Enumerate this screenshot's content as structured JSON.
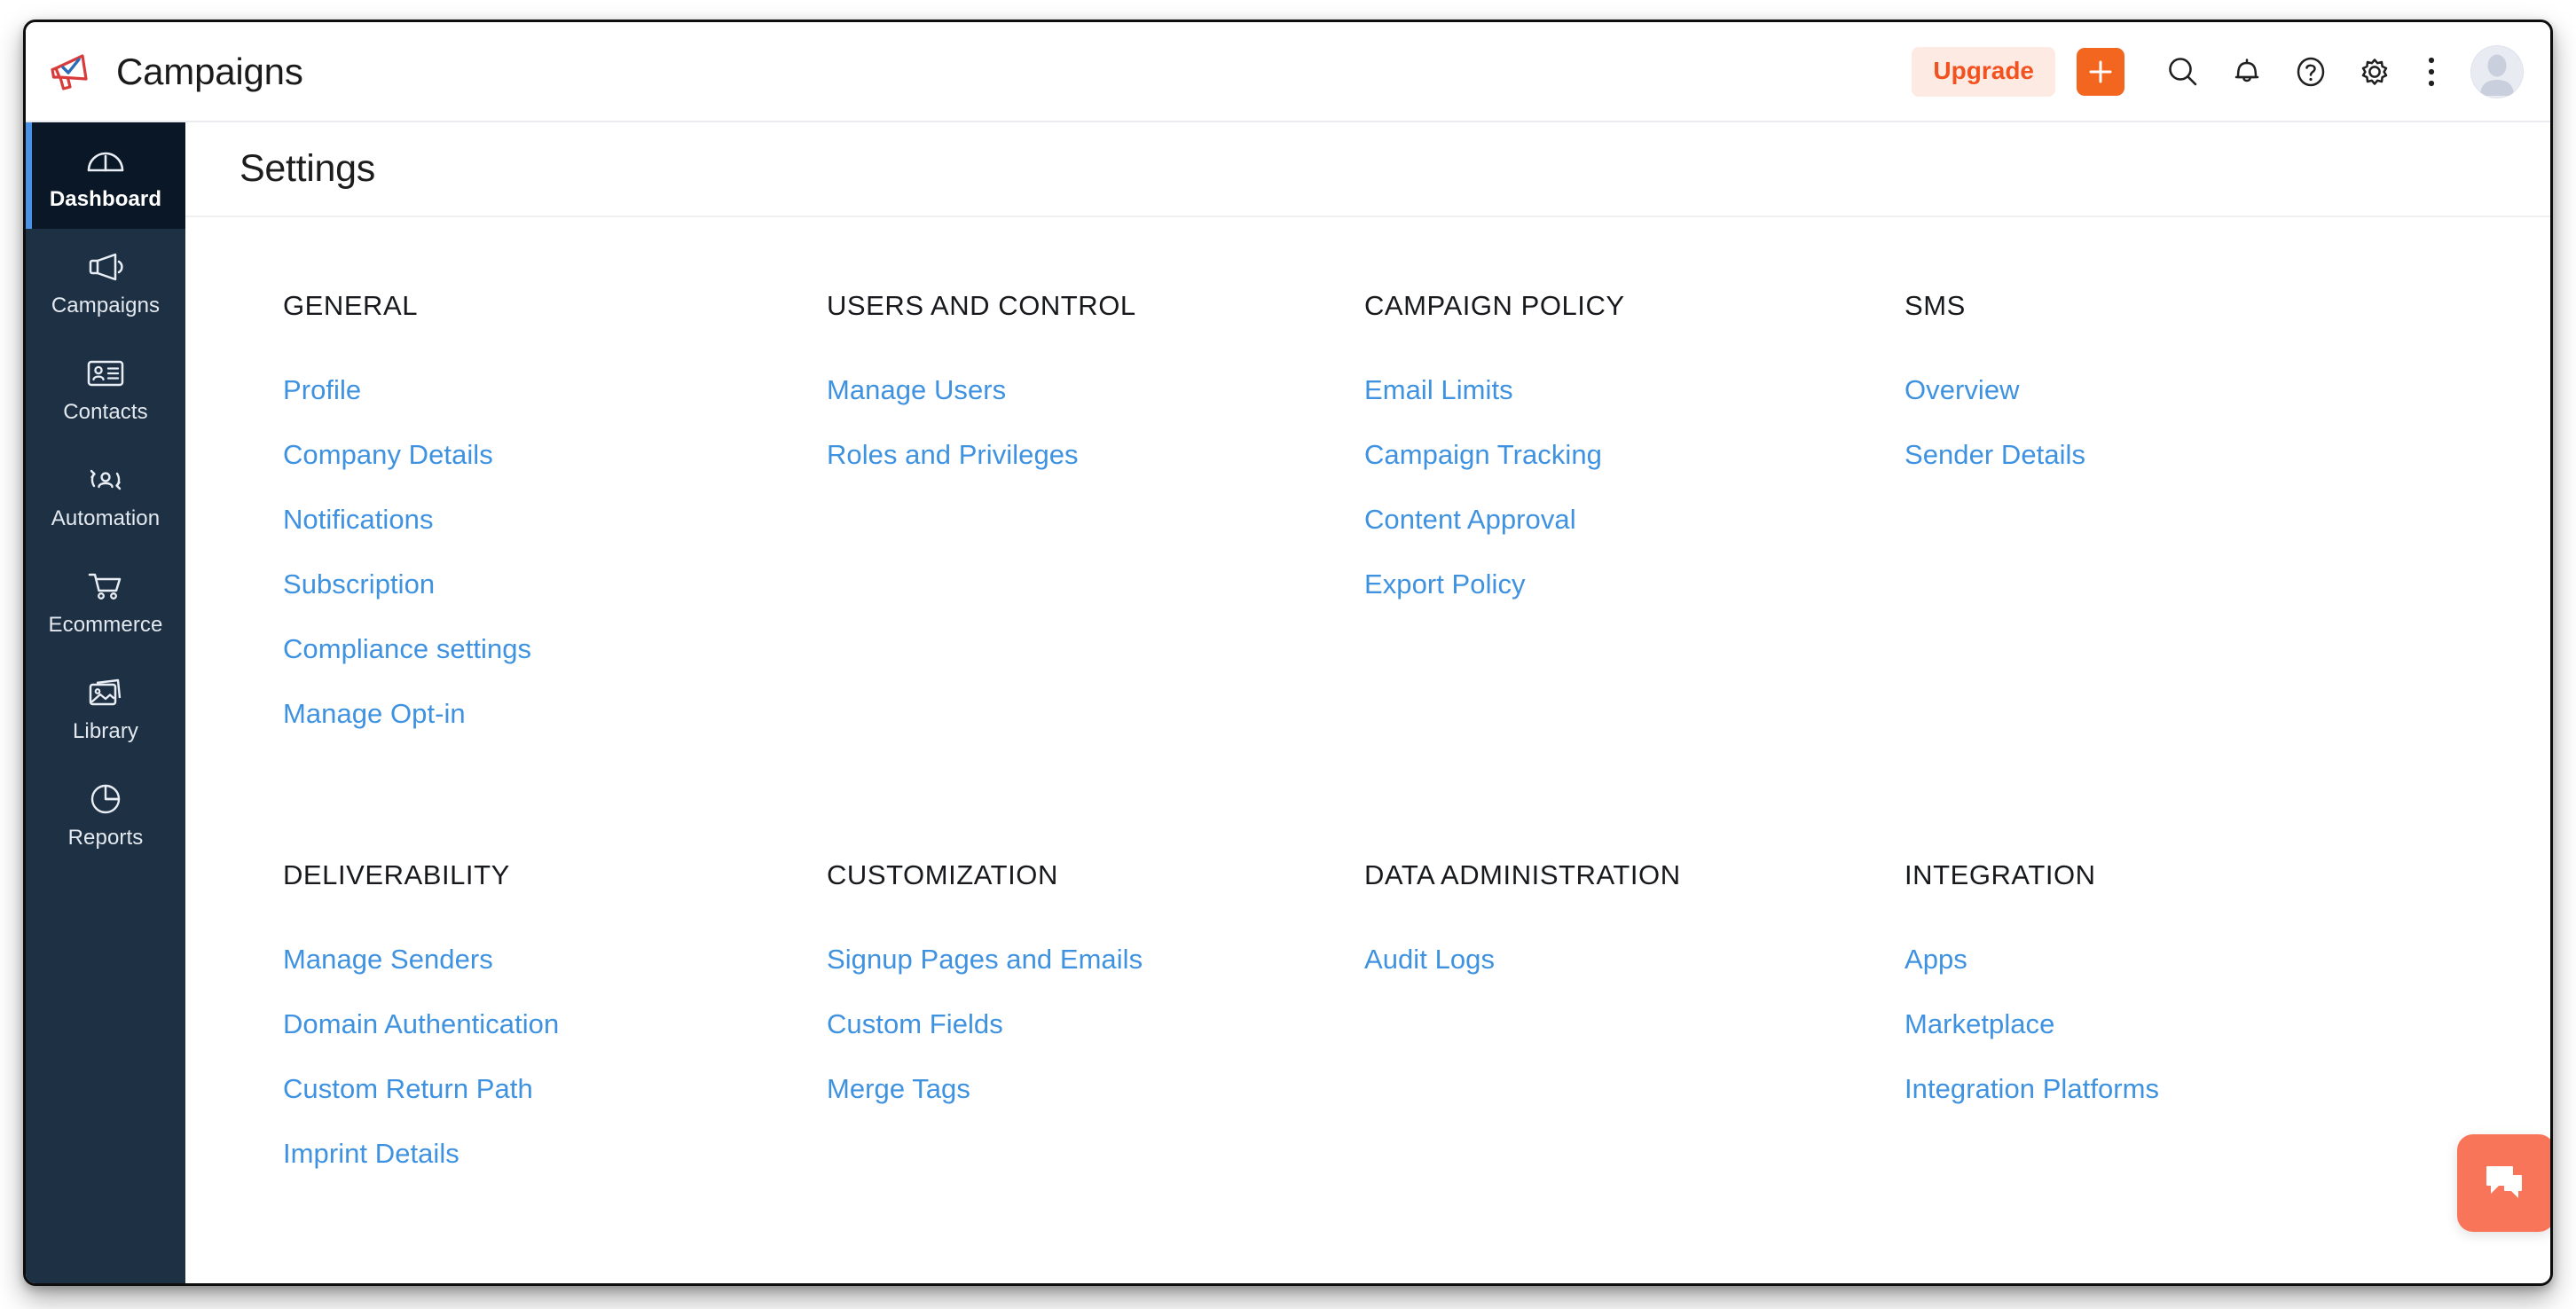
{
  "app": {
    "title": "Campaigns",
    "logo_icon": "megaphone-check-logo"
  },
  "topbar": {
    "upgrade_label": "Upgrade",
    "icons": {
      "add": "plus-icon",
      "search": "search-icon",
      "notifications": "bell-icon",
      "help": "question-circle-icon",
      "settings": "gear-icon",
      "more": "kebab-menu-icon",
      "avatar": "user-avatar-icon"
    }
  },
  "sidebar": {
    "items": [
      {
        "label": "Dashboard",
        "icon": "gauge-icon",
        "active": true
      },
      {
        "label": "Campaigns",
        "icon": "megaphone-icon",
        "active": false
      },
      {
        "label": "Contacts",
        "icon": "id-card-icon",
        "active": false
      },
      {
        "label": "Automation",
        "icon": "user-sync-icon",
        "active": false
      },
      {
        "label": "Ecommerce",
        "icon": "cart-icon",
        "active": false
      },
      {
        "label": "Library",
        "icon": "images-icon",
        "active": false
      },
      {
        "label": "Reports",
        "icon": "pie-chart-icon",
        "active": false
      }
    ]
  },
  "main": {
    "page_title": "Settings",
    "groups": [
      {
        "title": "GENERAL",
        "links": [
          "Profile",
          "Company Details",
          "Notifications",
          "Subscription",
          "Compliance settings",
          "Manage Opt-in"
        ]
      },
      {
        "title": "USERS AND CONTROL",
        "links": [
          "Manage Users",
          "Roles and Privileges"
        ]
      },
      {
        "title": "CAMPAIGN POLICY",
        "links": [
          "Email Limits",
          "Campaign Tracking",
          "Content Approval",
          "Export Policy"
        ]
      },
      {
        "title": "SMS",
        "links": [
          "Overview",
          "Sender Details"
        ]
      },
      {
        "title": "DELIVERABILITY",
        "links": [
          "Manage Senders",
          "Domain Authentication",
          "Custom Return Path",
          "Imprint Details"
        ]
      },
      {
        "title": "CUSTOMIZATION",
        "links": [
          "Signup Pages and Emails",
          "Custom Fields",
          "Merge Tags"
        ]
      },
      {
        "title": "DATA ADMINISTRATION",
        "links": [
          "Audit Logs"
        ]
      },
      {
        "title": "INTEGRATION",
        "links": [
          "Apps",
          "Marketplace",
          "Integration Platforms"
        ]
      }
    ]
  },
  "chat": {
    "icon": "chat-bubbles-icon"
  },
  "colors": {
    "accent_orange": "#f2661f",
    "upgrade_text": "#f2521f",
    "upgrade_bg": "#fdeae2",
    "link_blue": "#3e92e0",
    "sidebar_bg": "#1e3044",
    "sidebar_active_bg": "#0a1726",
    "sidebar_active_bar": "#4a92e8",
    "chat_bg": "#f8755a",
    "logo_red": "#d93b3b",
    "logo_blue": "#2b6cb8"
  }
}
